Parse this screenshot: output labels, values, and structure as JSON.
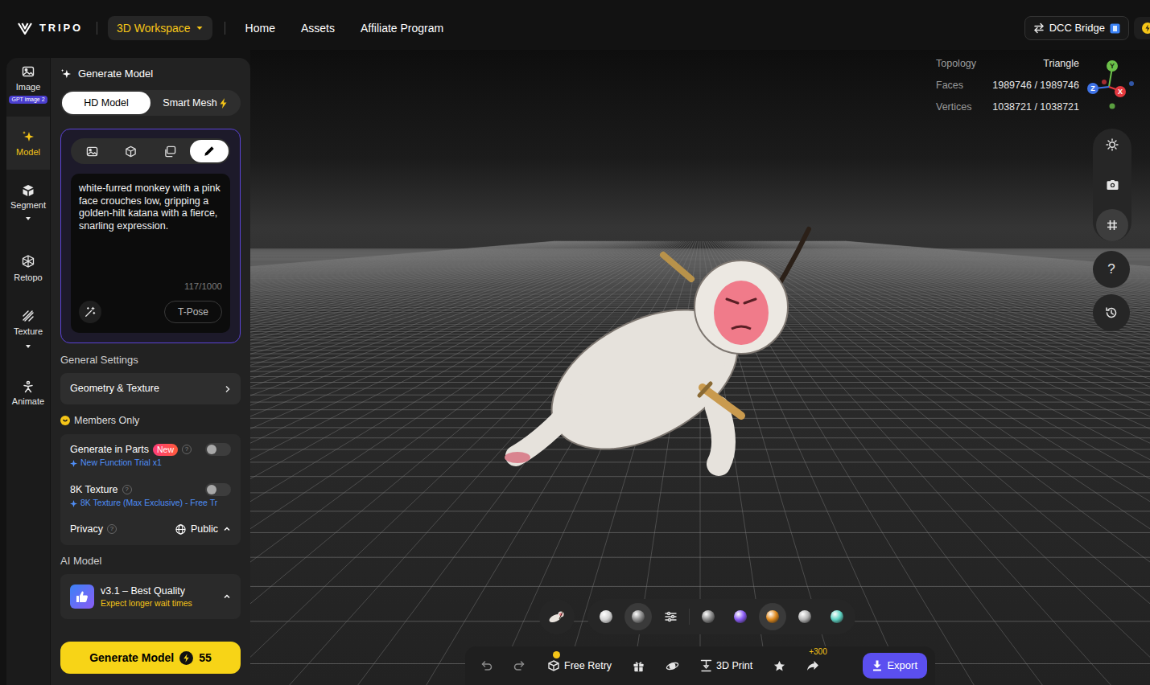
{
  "nav": {
    "logo": "TRIPO",
    "workspace": "3D Workspace",
    "links": [
      {
        "label": "Home"
      },
      {
        "label": "Assets"
      },
      {
        "label": "Affiliate Program"
      }
    ],
    "bridge": "DCC Bridge"
  },
  "rail": [
    {
      "label": "Image",
      "badge": "GPT image 2",
      "selected": false,
      "expandable": false
    },
    {
      "label": "Model",
      "selected": true,
      "expandable": false
    },
    {
      "label": "Segment",
      "selected": false,
      "expandable": true
    },
    {
      "label": "Retopo",
      "selected": false,
      "expandable": false
    },
    {
      "label": "Texture",
      "selected": false,
      "expandable": true
    },
    {
      "label": "Animate",
      "selected": false,
      "expandable": false
    }
  ],
  "panel": {
    "title": "Generate Model",
    "modes": [
      {
        "label": "HD Model",
        "selected": true,
        "boosted": false
      },
      {
        "label": "Smart Mesh",
        "selected": false,
        "boosted": true
      }
    ],
    "input_modes": [
      {
        "selected": false
      },
      {
        "selected": false
      },
      {
        "selected": false
      },
      {
        "selected": true
      }
    ],
    "prompt": {
      "text": "white-furred monkey with a pink face crouches low, gripping a golden-hilt katana with a fierce, snarling expression.",
      "counter": "117/1000",
      "pose": "T-Pose"
    },
    "general_heading": "General Settings",
    "geometry": "Geometry & Texture",
    "members_heading": "Members Only",
    "options": [
      {
        "label": "Generate in Parts",
        "badge": "New",
        "hint": "?",
        "on": false,
        "note": "New Function Trial x1"
      },
      {
        "label": "8K Texture",
        "hint": "?",
        "on": false,
        "note": "8K Texture (Max Exclusive) - Free Tr"
      }
    ],
    "privacy": {
      "label": "Privacy",
      "hint": "?",
      "value": "Public"
    },
    "ai_heading": "AI Model",
    "ai_model": {
      "name": "v3.1 – Best Quality",
      "note": "Expect longer wait times"
    },
    "generate": {
      "label": "Generate Model",
      "cost": "55"
    }
  },
  "viewport": {
    "stats": [
      {
        "label": "Topology",
        "value": "Triangle"
      },
      {
        "label": "Faces",
        "value": "1989746 / 1989746"
      },
      {
        "label": "Vertices",
        "value": "1038721 / 1038721"
      }
    ],
    "axes": [
      {
        "label": "Y",
        "color": "#6cc04a"
      },
      {
        "label": "Z",
        "color": "#3f73e6"
      },
      {
        "label": "X",
        "color": "#e5393f"
      }
    ],
    "tools": [
      {
        "selected": false
      },
      {
        "selected": false
      },
      {
        "selected": true
      }
    ],
    "help": "?",
    "render_modes": [
      {
        "selected": false
      },
      {
        "selected": true
      }
    ],
    "materials": [
      {
        "color": "#8c8c8c",
        "selected": false
      },
      {
        "color": "#8b5cf6",
        "selected": false
      },
      {
        "color": "#e08a1e",
        "selected": true
      },
      {
        "color": "#b5b5b5",
        "selected": false
      },
      {
        "color": "#5fd4c4",
        "selected": false
      }
    ]
  },
  "actions": {
    "retry": "Free Retry",
    "print": "3D Print",
    "bonus": "+300",
    "export": "Export"
  }
}
